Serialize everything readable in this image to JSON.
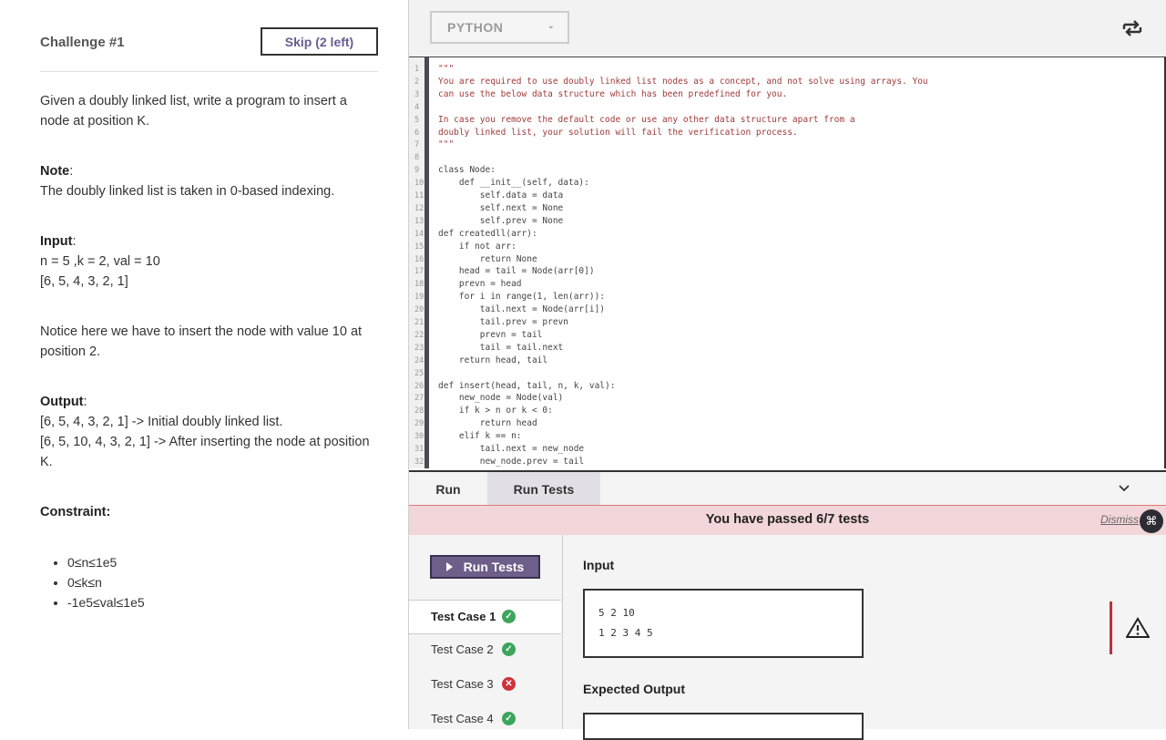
{
  "left": {
    "challenge_title": "Challenge #1",
    "skip_label": "Skip (2 left)",
    "description_1": "Given a doubly linked list, write a program to insert a node at position K.",
    "note_label": "Note",
    "note_text": "The doubly linked list is taken in 0-based indexing.",
    "input_label": "Input",
    "input_line_1": "n = 5 ,k = 2, val = 10",
    "input_line_2": "[6, 5, 4, 3, 2, 1]",
    "notice": "Notice here we have to insert the node with value 10 at position 2.",
    "output_label": "Output",
    "output_line_1": "[6, 5, 4, 3, 2, 1] -> Initial doubly linked list.",
    "output_line_2": "[6, 5, 10, 4, 3, 2, 1] -> After inserting the node at position K.",
    "constraint_label": "Constraint:",
    "constraints": [
      "0≤n≤1e5",
      "0≤k≤n",
      "-1e5≤val≤1e5"
    ]
  },
  "editor": {
    "language": "PYTHON",
    "swap_icon": "swap-arrows-icon",
    "code_lines": [
      "\"\"\"",
      "You are required to use doubly linked list nodes as a concept, and not solve using arrays. You",
      "can use the below data structure which has been predefined for you.",
      "",
      "In case you remove the default code or use any other data structure apart from a",
      "doubly linked list, your solution will fail the verification process.",
      "\"\"\"",
      "",
      "class Node:",
      "    def __init__(self, data):",
      "        self.data = data",
      "        self.next = None",
      "        self.prev = None",
      "def createdll(arr):",
      "    if not arr:",
      "        return None",
      "    head = tail = Node(arr[0])",
      "    prevn = head",
      "    for i in range(1, len(arr)):",
      "        tail.next = Node(arr[i])",
      "        tail.prev = prevn",
      "        prevn = tail",
      "        tail = tail.next",
      "    return head, tail",
      "",
      "def insert(head, tail, n, k, val):",
      "    new_node = Node(val)",
      "    if k > n or k < 0:",
      "        return head",
      "    elif k == n:",
      "        tail.next = new_node",
      "        new_node.prev = tail"
    ]
  },
  "bottom": {
    "tab_run": "Run",
    "tab_run_tests": "Run Tests",
    "banner_text": "You have passed 6/7 tests",
    "dismiss": "Dismiss",
    "run_tests_button": "Run Tests",
    "test_cases": [
      {
        "label": "Test Case 1",
        "status": "pass"
      },
      {
        "label": "Test Case 2",
        "status": "pass"
      },
      {
        "label": "Test Case 3",
        "status": "fail"
      },
      {
        "label": "Test Case 4",
        "status": "pass"
      }
    ],
    "input_title": "Input",
    "input_lines": [
      "5 2 10",
      "1 2 3 4 5"
    ],
    "expected_title": "Expected Output"
  },
  "colors": {
    "accent": "#6e5e8a",
    "pass": "#3ca55c",
    "fail": "#d0323c",
    "banner_bg": "#f3d6d9"
  }
}
